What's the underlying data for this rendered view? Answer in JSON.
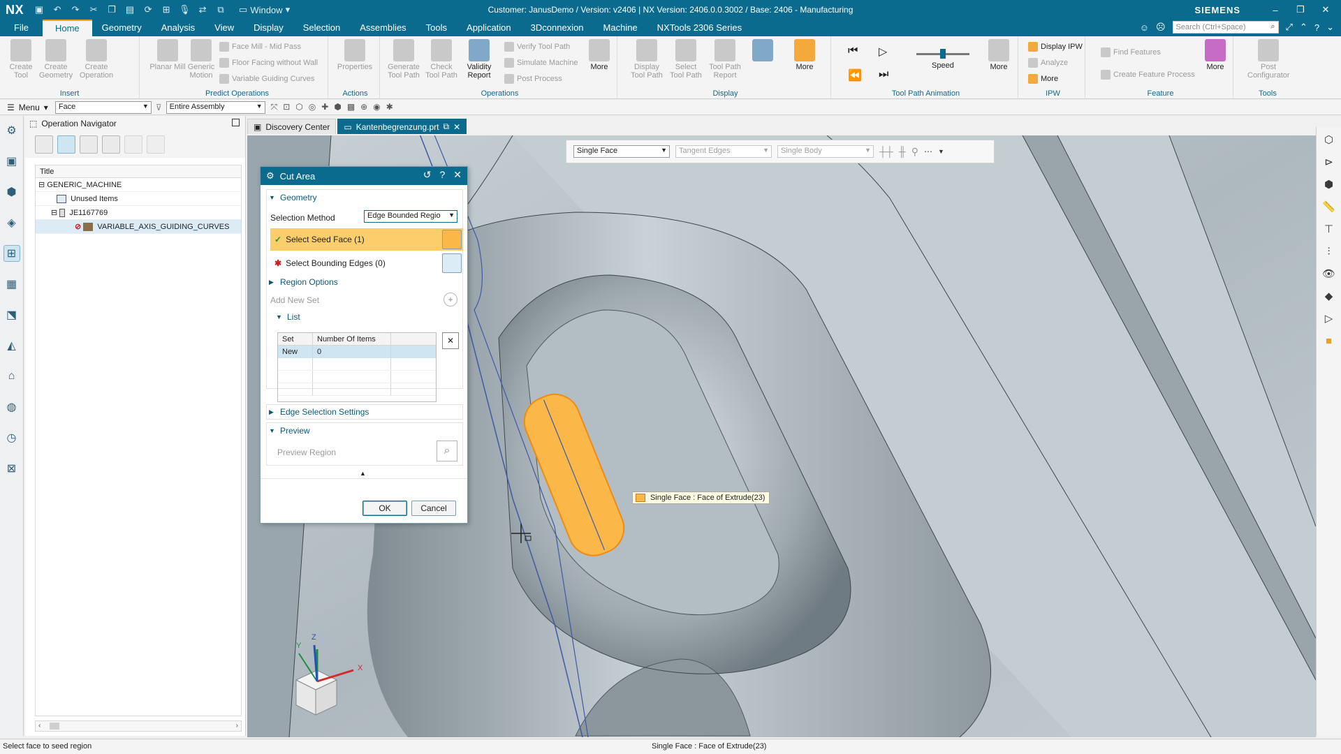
{
  "app": {
    "logo": "NX",
    "window_menu_label": "Window",
    "title": "Customer: JanusDemo / Version: v2406 | NX Version: 2406.0.0.3002 / Base: 2406 - Manufacturing",
    "brand": "SIEMENS"
  },
  "ribbon_tabs": [
    {
      "label": "File"
    },
    {
      "label": "Home"
    },
    {
      "label": "Geometry"
    },
    {
      "label": "Analysis"
    },
    {
      "label": "View"
    },
    {
      "label": "Display"
    },
    {
      "label": "Selection"
    },
    {
      "label": "Assemblies"
    },
    {
      "label": "Tools"
    },
    {
      "label": "Application"
    },
    {
      "label": "3Dconnexion"
    },
    {
      "label": "Machine"
    },
    {
      "label": "NXTools 2306 Series"
    }
  ],
  "search": {
    "placeholder": "Search (Ctrl+Space)"
  },
  "ribbon": {
    "insert": {
      "label": "Insert",
      "create_tool": "Create Tool",
      "create_geometry": "Create Geometry",
      "create_operation": "Create Operation"
    },
    "predict": {
      "label": "Predict Operations",
      "planar_mill": "Planar Mill",
      "generic_motion": "Generic Motion",
      "face_mill": "Face Mill - Mid Pass",
      "floor_facing": "Floor Facing without Wall",
      "variable_guiding": "Variable Guiding Curves"
    },
    "actions": {
      "label": "Actions",
      "properties": "Properties"
    },
    "operations": {
      "label": "Operations",
      "generate": "Generate Tool Path",
      "check": "Check Tool Path",
      "validity": "Validity Report",
      "verify": "Verify Tool Path",
      "simulate": "Simulate Machine",
      "post": "Post Process",
      "more": "More"
    },
    "display": {
      "label": "Display",
      "display_tp": "Display Tool Path",
      "select_tp": "Select Tool Path",
      "tp_report": "Tool Path Report",
      "more": "More"
    },
    "animation": {
      "label": "Tool Path Animation",
      "speed": "Speed",
      "more": "More"
    },
    "ipw": {
      "label": "IPW",
      "display_ipw": "Display IPW",
      "analyze": "Analyze",
      "more": "More"
    },
    "feature": {
      "label": "Feature",
      "find": "Find Features",
      "create_process": "Create Feature Process",
      "more": "More"
    },
    "tools": {
      "label": "Tools",
      "post_config": "Post Configurator"
    }
  },
  "selection_bar": {
    "menu_label": "Menu",
    "filter": "Face",
    "scope": "Entire Assembly"
  },
  "navigator": {
    "title": "Operation Navigator",
    "column": "Title",
    "rows": [
      {
        "label": "GENERIC_MACHINE"
      },
      {
        "label": "Unused Items"
      },
      {
        "label": "JE1167769"
      },
      {
        "label": "VARIABLE_AXIS_GUIDING_CURVES"
      }
    ]
  },
  "doc_tabs": [
    {
      "label": "Discovery Center"
    },
    {
      "label": "Kantenbegrenzung.prt"
    }
  ],
  "viewport_filter": {
    "face_rule": "Single Face",
    "edge_rule": "Tangent Edges",
    "body_rule": "Single Body"
  },
  "dialog": {
    "title": "Cut Area",
    "geometry_section": "Geometry",
    "selection_method_label": "Selection Method",
    "selection_method_value": "Edge Bounded Regio",
    "seed_face": "Select Seed Face (1)",
    "bounding_edges": "Select Bounding Edges (0)",
    "region_options": "Region Options",
    "add_new_set": "Add New Set",
    "list_section": "List",
    "list_headers": {
      "set": "Set",
      "count": "Number Of Items"
    },
    "list_rows": [
      {
        "set": "New",
        "count": "0"
      }
    ],
    "edge_settings": "Edge Selection Settings",
    "preview_section": "Preview",
    "preview_region": "Preview Region",
    "ok": "OK",
    "cancel": "Cancel"
  },
  "tooltip": "Single Face : Face of Extrude(23)",
  "triad": {
    "x": "X",
    "y": "Y",
    "z": "Z"
  },
  "status": {
    "left": "Select face to seed region",
    "center": "Single Face : Face of Extrude(23)"
  },
  "colors": {
    "title_bar": "#0a6b8e",
    "accent": "#f0a020",
    "highlight_face": "#fbb848",
    "viewport_bg": "#b9c3c9"
  }
}
